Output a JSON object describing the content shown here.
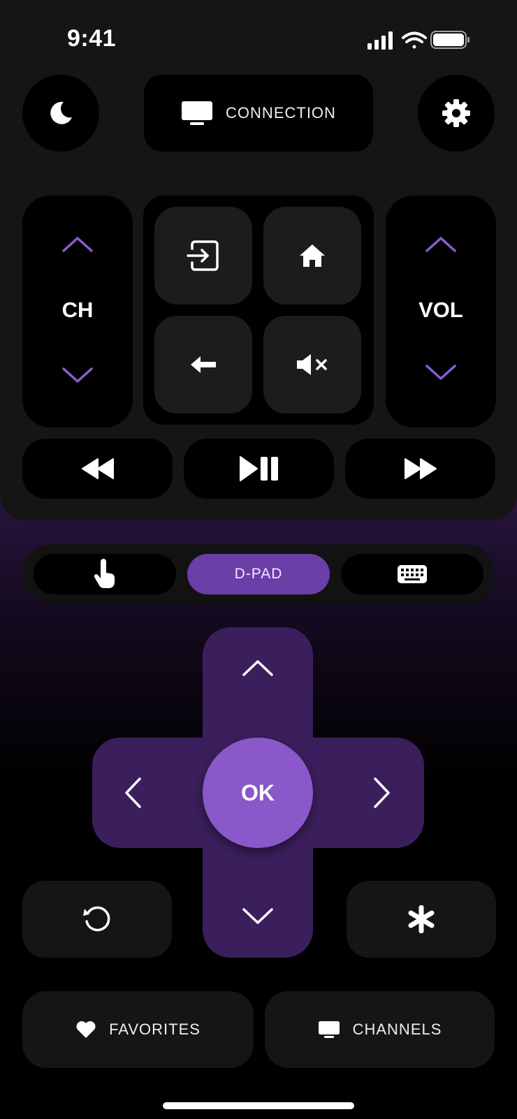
{
  "status_bar": {
    "time": "9:41"
  },
  "header": {
    "connection_label": "CONNECTION"
  },
  "channel": {
    "label": "CH"
  },
  "volume": {
    "label": "VOL"
  },
  "modes": {
    "dpad_label": "D-PAD",
    "active": "D-PAD"
  },
  "dpad": {
    "ok_label": "OK"
  },
  "bottom": {
    "favorites_label": "FAVORITES",
    "channels_label": "CHANNELS"
  },
  "colors": {
    "accent": "#6a3fa8",
    "dpad": "#3a1f5c",
    "ok": "#8a58c8",
    "arrow": "#8a5cd0"
  },
  "icons": [
    "moon-icon",
    "tv-icon",
    "gear-icon",
    "input-icon",
    "home-icon",
    "back-icon",
    "mute-icon",
    "rewind-icon",
    "play-pause-icon",
    "fast-forward-icon",
    "touch-icon",
    "keyboard-icon",
    "replay-icon",
    "asterisk-icon",
    "heart-icon"
  ]
}
